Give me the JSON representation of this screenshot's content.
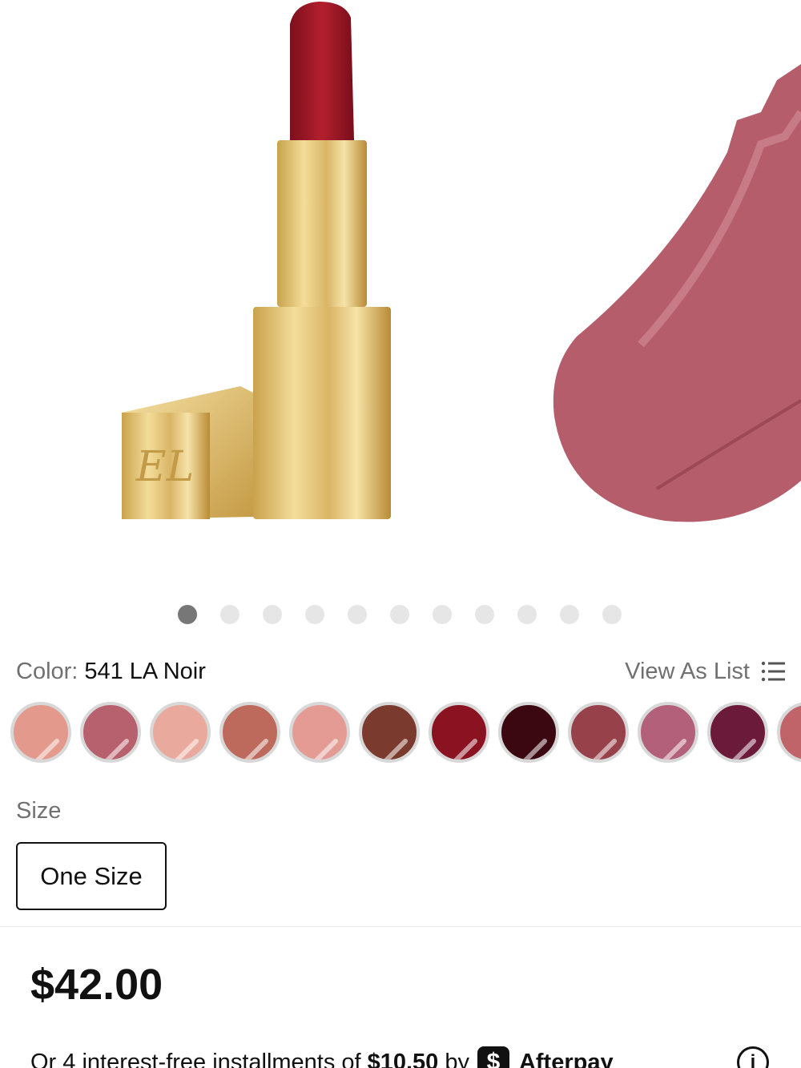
{
  "product": {
    "color_label": "Color:",
    "color_value": "541 LA Noir",
    "view_as_list": "View As List",
    "size_label": "Size",
    "size_option": "One Size",
    "price": "$42.00"
  },
  "gallery": {
    "dot_count": 11,
    "active_dot": 0,
    "lipstick_bullet_color": "#a11a2b",
    "swatch_smear_color": "#b55d6a"
  },
  "swatches": [
    "#e39a8c",
    "#b8616e",
    "#eaa99d",
    "#bd6a5c",
    "#e39b94",
    "#7a3a2e",
    "#8b1221",
    "#3b0710",
    "#97414a",
    "#b3607a",
    "#6b1a3a",
    "#c0646a"
  ],
  "installments": {
    "prefix": "Or 4 interest-free installments of",
    "amount": "$10.50",
    "by": "by",
    "provider": "Afterpay",
    "badge": "$"
  },
  "icons": {
    "list": "list-icon",
    "info": "info-icon"
  }
}
